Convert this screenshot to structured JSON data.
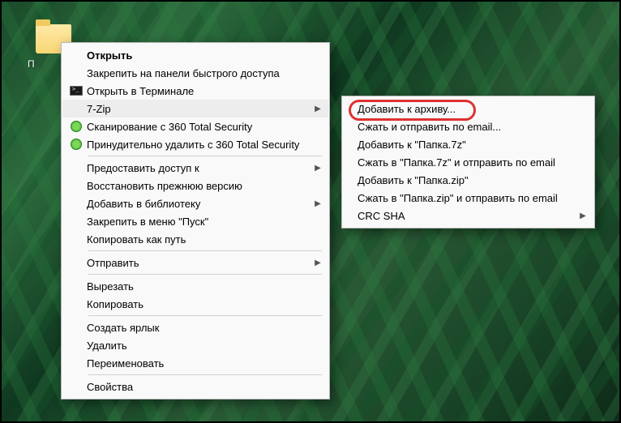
{
  "desktop": {
    "folder_label": "П"
  },
  "main_menu": {
    "items": [
      {
        "label": "Открыть",
        "bold": true
      },
      {
        "label": "Закрепить на панели быстрого доступа"
      },
      {
        "label": "Открыть в Терминале",
        "icon": "terminal"
      },
      {
        "label": "7-Zip",
        "submenu": true,
        "hover": true
      },
      {
        "label": "Сканирование с 360 Total Security",
        "icon": "360"
      },
      {
        "label": "Принудительно удалить с  360 Total Security",
        "icon": "360"
      },
      "sep",
      {
        "label": "Предоставить доступ к",
        "submenu": true
      },
      {
        "label": "Восстановить прежнюю версию"
      },
      {
        "label": "Добавить в библиотеку",
        "submenu": true
      },
      {
        "label": "Закрепить в меню \"Пуск\""
      },
      {
        "label": "Копировать как путь"
      },
      "sep",
      {
        "label": "Отправить",
        "submenu": true
      },
      "sep",
      {
        "label": "Вырезать"
      },
      {
        "label": "Копировать"
      },
      "sep",
      {
        "label": "Создать ярлык"
      },
      {
        "label": "Удалить"
      },
      {
        "label": "Переименовать"
      },
      "sep",
      {
        "label": "Свойства"
      }
    ]
  },
  "sub_menu": {
    "items": [
      {
        "label": "Добавить к архиву..."
      },
      {
        "label": "Сжать и отправить по email..."
      },
      {
        "label": "Добавить к \"Папка.7z\""
      },
      {
        "label": "Сжать в \"Папка.7z\" и отправить по email"
      },
      {
        "label": "Добавить к \"Папка.zip\""
      },
      {
        "label": "Сжать в \"Папка.zip\" и отправить по email"
      },
      {
        "label": "CRC SHA",
        "submenu": true
      }
    ]
  }
}
